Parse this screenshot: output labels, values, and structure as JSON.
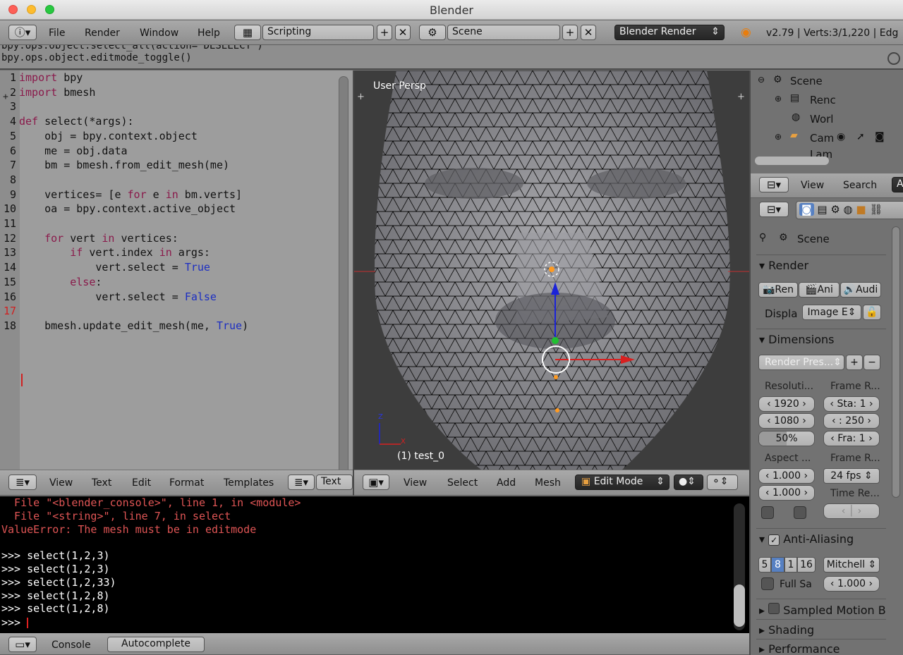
{
  "window": {
    "title": "Blender"
  },
  "topbar": {
    "menus": [
      "File",
      "Render",
      "Window",
      "Help"
    ],
    "screen": "Scripting",
    "scene": "Scene",
    "engine": "Blender Render",
    "stats": "v2.79 | Verts:3/1,220 | Edg"
  },
  "info_log": [
    "bpy.ops.object.select_all(action='DESELECT')",
    "bpy.ops.object.editmode_toggle()"
  ],
  "text_editor": {
    "lines": [
      {
        "n": "1",
        "t": "import bpy"
      },
      {
        "n": "2",
        "t": "import bmesh"
      },
      {
        "n": "3",
        "t": ""
      },
      {
        "n": "4",
        "t": "def select(*args):"
      },
      {
        "n": "5",
        "t": "    obj = bpy.context.object"
      },
      {
        "n": "6",
        "t": "    me = obj.data"
      },
      {
        "n": "7",
        "t": "    bm = bmesh.from_edit_mesh(me)"
      },
      {
        "n": "8",
        "t": ""
      },
      {
        "n": "9",
        "t": "    vertices= [e for e in bm.verts]"
      },
      {
        "n": "10",
        "t": "    oa = bpy.context.active_object"
      },
      {
        "n": "11",
        "t": ""
      },
      {
        "n": "12",
        "t": "    for vert in vertices:"
      },
      {
        "n": "13",
        "t": "        if vert.index in args:"
      },
      {
        "n": "14",
        "t": "            vert.select = True"
      },
      {
        "n": "15",
        "t": "        else:"
      },
      {
        "n": "16",
        "t": "            vert.select = False"
      },
      {
        "n": "17",
        "t": ""
      },
      {
        "n": "18",
        "t": "    bmesh.update_edit_mesh(me, True)"
      }
    ],
    "menus": [
      "View",
      "Text",
      "Edit",
      "Format",
      "Templates"
    ],
    "text_name": "Text"
  },
  "viewport": {
    "label": "User Persp",
    "object_label": "(1) test_0",
    "axis_z": "Z",
    "axis_x": "X",
    "menus": [
      "View",
      "Select",
      "Add",
      "Mesh"
    ],
    "mode": "Edit Mode"
  },
  "console": {
    "lines": [
      {
        "t": "  File \"<blender_console>\", line 1, in <module>",
        "err": true
      },
      {
        "t": "  File \"<string>\", line 7, in select",
        "err": true
      },
      {
        "t": "ValueError: The mesh must be in editmode",
        "err": true
      },
      {
        "t": "",
        "err": false
      },
      {
        "t": ">>> select(1,2,3)",
        "err": false
      },
      {
        "t": ">>> select(1,2,3)",
        "err": false
      },
      {
        "t": ">>> select(1,2,33)",
        "err": false
      },
      {
        "t": ">>> select(1,2,8)",
        "err": false
      },
      {
        "t": ">>> select(1,2,8)",
        "err": false
      }
    ],
    "prompt": ">>> ",
    "menus": [
      "Console"
    ],
    "autocomplete": "Autocomplete"
  },
  "outliner": {
    "items": [
      "Scene",
      "Renc",
      "Worl",
      "Cam",
      "Lam"
    ]
  },
  "outliner_header": {
    "menus": [
      "View",
      "Search"
    ],
    "all": "A"
  },
  "properties": {
    "context": "Scene",
    "render": {
      "title": "Render",
      "buttons": [
        "Ren",
        "Ani",
        "Audi"
      ],
      "display_label": "Displa",
      "display_value": "Image E"
    },
    "dimensions": {
      "title": "Dimensions",
      "preset": "Render Pres...",
      "resolution_label": "Resoluti...",
      "res_x": "1920",
      "res_y": "1080",
      "res_pct": "50%",
      "res_pct_fill": 0.5,
      "frame_range_label": "Frame R...",
      "start": "Sta: 1",
      "end": ": 250",
      "frame": "Fra: 1",
      "aspect_label": "Aspect ...",
      "aspect_x": "1.000",
      "aspect_y": "1.000",
      "frame_rate_label": "Frame R...",
      "fps": "24 fps",
      "time_remap_label": "Time Re..."
    },
    "anti_aliasing": {
      "title": "Anti-Aliasing",
      "samples": [
        "5",
        "8",
        "1",
        "16"
      ],
      "selected": "8",
      "filter": "Mitchell",
      "full_sample": "Full Sa",
      "size": "1.000"
    },
    "collapsed": [
      "Sampled Motion B",
      "Shading",
      "Performance"
    ]
  }
}
